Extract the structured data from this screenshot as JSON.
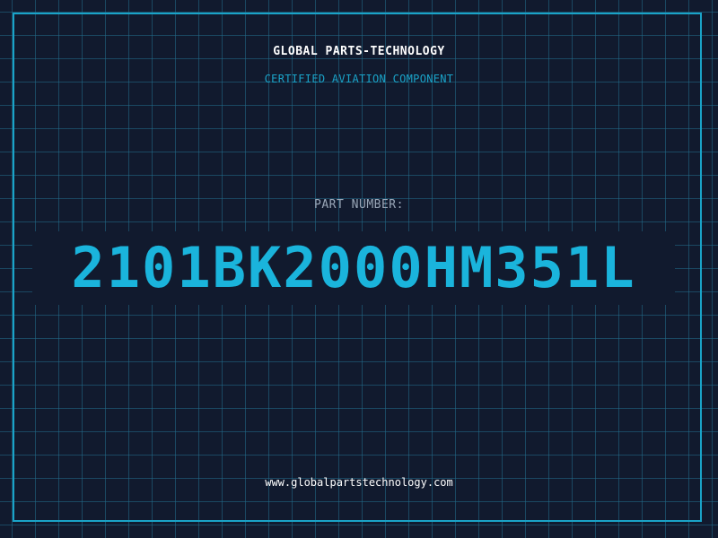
{
  "company": {
    "name": "GLOBAL PARTS-TECHNOLOGY",
    "tagline": "CERTIFIED AVIATION COMPONENT"
  },
  "part": {
    "label": "PART NUMBER:",
    "number": "2101BK2000HM351L"
  },
  "footer": {
    "website": "www.globalpartstechnology.com"
  },
  "colors": {
    "background": "#111a2e",
    "grid": "#226e8c",
    "accent": "#1ab4dc",
    "frame": "#1aa3c8",
    "label": "#9aa7b8",
    "text": "#ffffff"
  }
}
